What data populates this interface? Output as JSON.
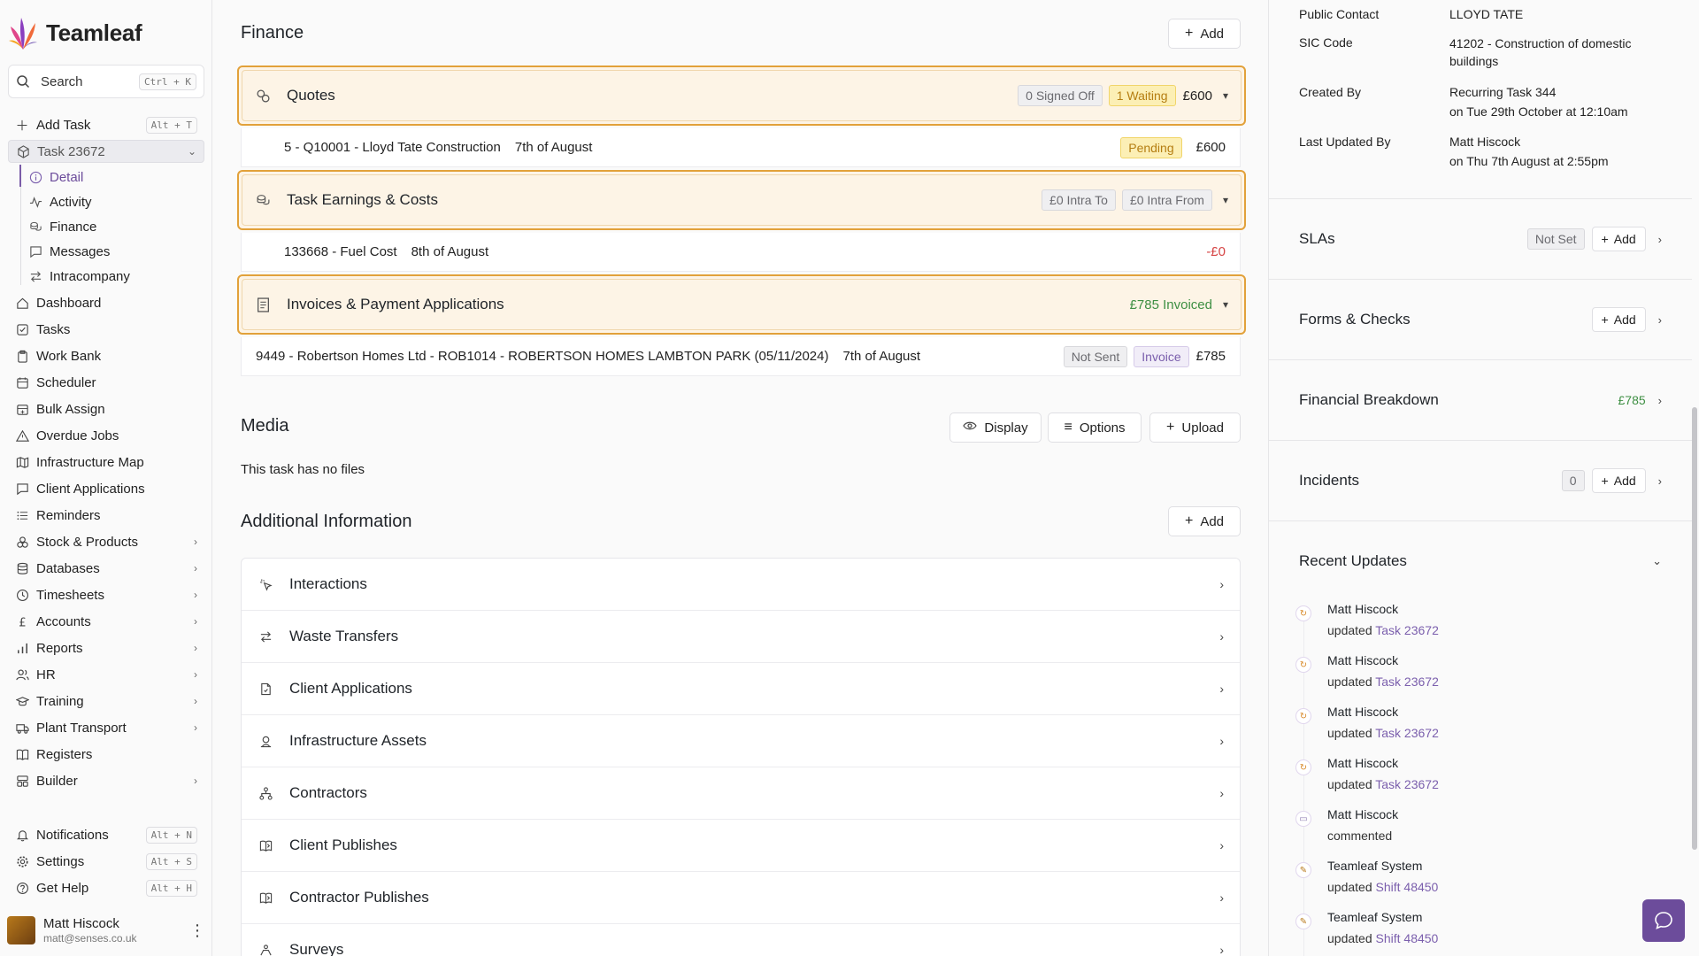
{
  "app": {
    "name": "Teamleaf"
  },
  "search": {
    "label": "Search",
    "shortcut": "Ctrl + K"
  },
  "sidebar": {
    "add_task": {
      "label": "Add Task",
      "shortcut": "Alt + T"
    },
    "task": {
      "label": "Task 23672"
    },
    "task_sub": [
      "Detail",
      "Activity",
      "Finance",
      "Messages",
      "Intracompany"
    ],
    "items": [
      {
        "label": "Dashboard",
        "icon": "home-icon"
      },
      {
        "label": "Tasks",
        "icon": "check-square-icon"
      },
      {
        "label": "Work Bank",
        "icon": "clipboard-icon"
      },
      {
        "label": "Scheduler",
        "icon": "calendar-icon"
      },
      {
        "label": "Bulk Assign",
        "icon": "calendar-plus-icon"
      },
      {
        "label": "Overdue Jobs",
        "icon": "warning-icon"
      },
      {
        "label": "Infrastructure Map",
        "icon": "map-icon"
      },
      {
        "label": "Client Applications",
        "icon": "message-icon"
      },
      {
        "label": "Reminders",
        "icon": "list-icon"
      },
      {
        "label": "Stock & Products",
        "icon": "boxes-icon",
        "chevron": true
      },
      {
        "label": "Databases",
        "icon": "database-icon",
        "chevron": true
      },
      {
        "label": "Timesheets",
        "icon": "clock-icon",
        "chevron": true
      },
      {
        "label": "Accounts",
        "icon": "pound-icon",
        "chevron": true
      },
      {
        "label": "Reports",
        "icon": "bar-chart-icon",
        "chevron": true
      },
      {
        "label": "HR",
        "icon": "users-icon",
        "chevron": true
      },
      {
        "label": "Training",
        "icon": "graduation-icon",
        "chevron": true
      },
      {
        "label": "Plant Transport",
        "icon": "truck-icon",
        "chevron": true
      },
      {
        "label": "Registers",
        "icon": "book-icon"
      },
      {
        "label": "Builder",
        "icon": "layout-icon",
        "chevron": true
      }
    ],
    "bottom": [
      {
        "label": "Notifications",
        "shortcut": "Alt + N",
        "icon": "bell-icon"
      },
      {
        "label": "Settings",
        "shortcut": "Alt + S",
        "icon": "gear-icon"
      },
      {
        "label": "Get Help",
        "shortcut": "Alt + H",
        "icon": "help-icon"
      }
    ],
    "user": {
      "name": "Matt Hiscock",
      "email": "matt@senses.co.uk"
    }
  },
  "finance": {
    "title": "Finance",
    "add_label": "Add",
    "quotes": {
      "title": "Quotes",
      "badge_signed": "0 Signed Off",
      "badge_waiting": "1 Waiting",
      "amount": "£600",
      "row": {
        "ref": "5 - Q10001 - Lloyd Tate Construction",
        "date": "7th of August",
        "status": "Pending",
        "amount": "£600"
      }
    },
    "earnings": {
      "title": "Task Earnings & Costs",
      "badge_to": "£0 Intra To",
      "badge_from": "£0 Intra From",
      "row": {
        "ref": "133668 - Fuel Cost",
        "date": "8th of August",
        "amount": "-£0"
      }
    },
    "invoices": {
      "title": "Invoices & Payment Applications",
      "invoiced": "£785 Invoiced",
      "row": {
        "ref": "9449 - Robertson Homes Ltd - ROB1014 - ROBERTSON HOMES LAMBTON PARK (05/11/2024)",
        "date": "7th of August",
        "badge_status": "Not Sent",
        "badge_type": "Invoice",
        "amount": "£785"
      }
    }
  },
  "media": {
    "title": "Media",
    "display_label": "Display",
    "options_label": "Options",
    "upload_label": "Upload",
    "empty": "This task has no files"
  },
  "additional": {
    "title": "Additional Information",
    "add_label": "Add",
    "rows": [
      {
        "label": "Interactions",
        "icon": "sparkle-pointer-icon"
      },
      {
        "label": "Waste Transfers",
        "icon": "swap-icon"
      },
      {
        "label": "Client Applications",
        "icon": "file-icon"
      },
      {
        "label": "Infrastructure Assets",
        "icon": "user-pin-icon"
      },
      {
        "label": "Contractors",
        "icon": "network-icon"
      },
      {
        "label": "Client Publishes",
        "icon": "book-open-icon"
      },
      {
        "label": "Contractor Publishes",
        "icon": "book-open-icon"
      },
      {
        "label": "Surveys",
        "icon": "survey-icon"
      }
    ]
  },
  "details": {
    "public_contact": {
      "label": "Public Contact",
      "value": "LLOYD TATE"
    },
    "sic_code": {
      "label": "SIC Code",
      "value": "41202 - Construction of domestic buildings"
    },
    "created_by": {
      "label": "Created By",
      "value": "Recurring Task 344",
      "when": "on Tue 29th October at 12:10am"
    },
    "last_updated_by": {
      "label": "Last Updated By",
      "value": "Matt Hiscock",
      "when": "on Thu 7th August at 2:55pm"
    }
  },
  "panels": {
    "slas": {
      "title": "SLAs",
      "badge": "Not Set",
      "add_label": "Add"
    },
    "forms": {
      "title": "Forms & Checks",
      "add_label": "Add"
    },
    "financial": {
      "title": "Financial Breakdown",
      "amount": "£785"
    },
    "incidents": {
      "title": "Incidents",
      "count": "0",
      "add_label": "Add"
    },
    "recent": {
      "title": "Recent Updates"
    }
  },
  "updates": [
    {
      "who": "Matt Hiscock",
      "action": "updated",
      "link": "Task 23672",
      "icon": "refresh-icon"
    },
    {
      "who": "Matt Hiscock",
      "action": "updated",
      "link": "Task 23672",
      "icon": "refresh-icon"
    },
    {
      "who": "Matt Hiscock",
      "action": "updated",
      "link": "Task 23672",
      "icon": "refresh-icon"
    },
    {
      "who": "Matt Hiscock",
      "action": "updated",
      "link": "Task 23672",
      "icon": "refresh-icon"
    },
    {
      "who": "Matt Hiscock",
      "action": "commented",
      "link": "",
      "icon": "comment-icon"
    },
    {
      "who": "Teamleaf System",
      "action": "updated",
      "link": "Shift 48450",
      "icon": "pencil-icon"
    },
    {
      "who": "Teamleaf System",
      "action": "updated",
      "link": "Shift 48450",
      "icon": "pencil-icon"
    }
  ],
  "colors": {
    "accent": "#6c4c9b",
    "highlight_border": "#e2a13a",
    "highlight_bg": "#fdf4e6",
    "positive": "#3e8f43",
    "negative": "#d64545"
  }
}
